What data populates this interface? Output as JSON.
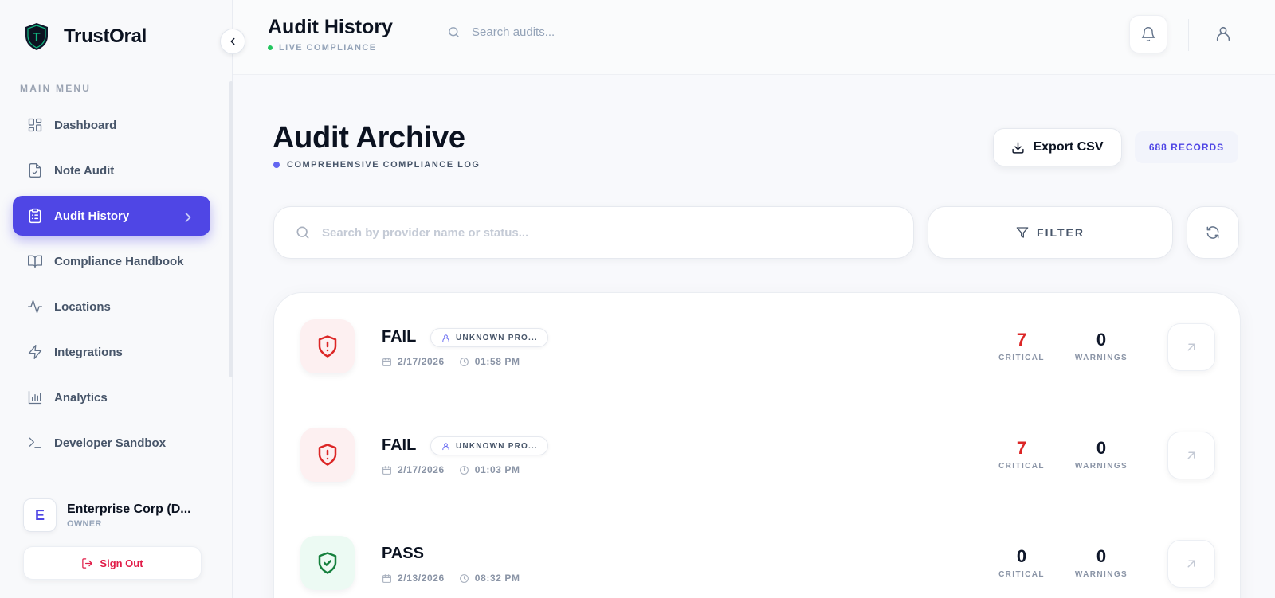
{
  "brand": {
    "name": "TrustOral",
    "logo_letter": "T"
  },
  "sidebar": {
    "menu_title": "MAIN MENU",
    "items": [
      {
        "label": "Dashboard",
        "icon": "grid-icon"
      },
      {
        "label": "Note Audit",
        "icon": "file-check-icon"
      },
      {
        "label": "Audit History",
        "icon": "clipboard-list-icon",
        "active": true
      },
      {
        "label": "Compliance Handbook",
        "icon": "book-icon"
      },
      {
        "label": "Locations",
        "icon": "activity-icon"
      },
      {
        "label": "Integrations",
        "icon": "zap-icon"
      },
      {
        "label": "Analytics",
        "icon": "bar-chart-icon"
      },
      {
        "label": "Developer Sandbox",
        "icon": "terminal-icon"
      }
    ],
    "org": {
      "initial": "E",
      "name": "Enterprise Corp (D...",
      "role": "OWNER"
    },
    "signout_label": "Sign Out"
  },
  "topbar": {
    "title": "Audit History",
    "status": "LIVE COMPLIANCE",
    "search_placeholder": "Search audits..."
  },
  "main": {
    "title": "Audit Archive",
    "subtitle": "COMPREHENSIVE COMPLIANCE LOG",
    "export_label": "Export CSV",
    "records_label": "688 RECORDS",
    "search_placeholder": "Search by provider name or status...",
    "filter_label": "FILTER",
    "rows": [
      {
        "status": "FAIL",
        "provider": "UNKNOWN PRO...",
        "date": "2/17/2026",
        "time": "01:58 PM",
        "critical": "7",
        "critical_label": "CRITICAL",
        "warnings": "0",
        "warnings_label": "WARNINGS"
      },
      {
        "status": "FAIL",
        "provider": "UNKNOWN PRO...",
        "date": "2/17/2026",
        "time": "01:03 PM",
        "critical": "7",
        "critical_label": "CRITICAL",
        "warnings": "0",
        "warnings_label": "WARNINGS"
      },
      {
        "status": "PASS",
        "date": "2/13/2026",
        "time": "08:32 PM",
        "critical": "0",
        "critical_label": "CRITICAL",
        "warnings": "0",
        "warnings_label": "WARNINGS"
      }
    ]
  },
  "colors": {
    "accent": "#4f46e5",
    "fail": "#dc2626",
    "pass": "#15803d",
    "live": "#22c55e"
  }
}
